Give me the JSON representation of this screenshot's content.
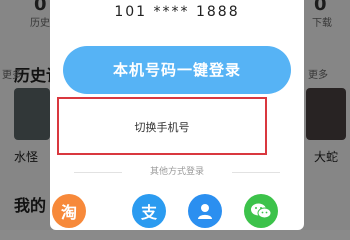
{
  "background": {
    "stat_left": "0",
    "stat_left_label": "历史",
    "stat_right": "0",
    "stat_right_label": "下载",
    "history_title": "历史记",
    "more_left": "更多",
    "more_right": "更多",
    "item_left": "水怪",
    "item_right": "大蛇",
    "mine_title": "我的"
  },
  "dialog": {
    "masked_phone": "101 **** 1888",
    "primary_button": "本机号码一键登录",
    "switch_phone": "切换手机号",
    "other_methods": "其他方式登录"
  },
  "providers": [
    {
      "name": "taobao",
      "glyph": "淘",
      "color": "#f7893a"
    },
    {
      "name": "alipay",
      "glyph": "支",
      "color": "#2b9bf0"
    },
    {
      "name": "account",
      "glyph": "",
      "color": "#2b8ff0"
    },
    {
      "name": "wechat",
      "glyph": "",
      "color": "#3cc24a"
    }
  ]
}
